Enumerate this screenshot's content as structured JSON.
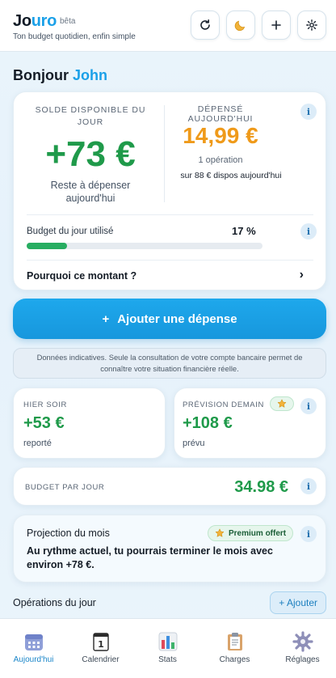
{
  "header": {
    "logo_main": "Jo",
    "logo_accent": "uro",
    "beta": "bêta",
    "tagline": "Ton budget quotidien, enfin simple",
    "buttons": [
      {
        "icon": "refresh-icon"
      },
      {
        "icon": "moon-icon"
      },
      {
        "icon": "plus-icon"
      },
      {
        "icon": "gear-icon"
      }
    ]
  },
  "greeting": {
    "prefix": "Bonjour",
    "name": "John"
  },
  "summary": {
    "available_label": "SOLDE DISPONIBLE DU JOUR",
    "available_value": "+73 €",
    "available_sub": "Reste à dépenser aujourd'hui",
    "spent_label": "DÉPENSÉ AUJOURD'HUI",
    "spent_value": "14,99 €",
    "spent_count": "1 opération",
    "spent_sub": "sur 88 € dispos aujourd'hui",
    "progress_label": "Budget du jour utilisé",
    "progress_text": "17 %",
    "progress_fraction": 0.17,
    "why_label": "Pourquoi ce montant ?",
    "chevron": "›",
    "info": "i"
  },
  "cta": {
    "icon": "+",
    "label": "Ajouter une dépense"
  },
  "notice": "Données indicatives. Seule la consultation de votre compte bancaire permet de connaître votre situation financière réelle.",
  "yesterday": {
    "label": "HIER SOIR",
    "value": "+53 €",
    "sub": "reporté"
  },
  "forecast": {
    "label": "PRÉVISION DEMAIN",
    "value": "+108 €",
    "sub": "prévu"
  },
  "per_day": {
    "label": "BUDGET PAR JOUR",
    "value": "34.98 €"
  },
  "projection": {
    "title": "Projection du mois",
    "badge": "Premium offert",
    "text": "Au rythme actuel, tu pourrais terminer le mois avec environ +78 €."
  },
  "operations": {
    "title": "Opérations du jour",
    "add_label": "+ Ajouter"
  },
  "tabs": [
    {
      "label": "Aujourd'hui",
      "icon": "calendar-grid-icon",
      "active": true
    },
    {
      "label": "Calendrier",
      "icon": "calendar-day-icon",
      "glyph": "1"
    },
    {
      "label": "Stats",
      "icon": "bar-chart-icon"
    },
    {
      "label": "Charges",
      "icon": "clipboard-icon"
    },
    {
      "label": "Réglages",
      "icon": "gear-icon"
    }
  ],
  "colors": {
    "accent": "#1aa0e8",
    "positive": "#1f9a4a",
    "spent": "#ef9a1a"
  }
}
